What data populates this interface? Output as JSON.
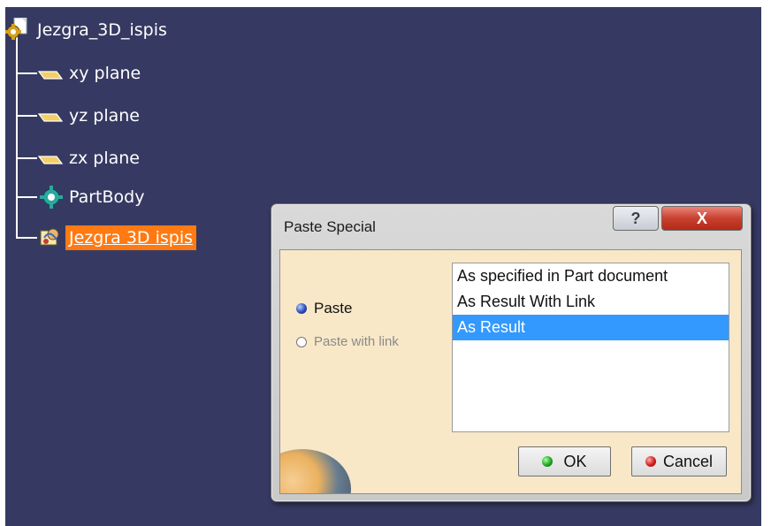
{
  "tree": {
    "root": {
      "label": "Jezgra_3D_ispis",
      "icon": "part-document-icon"
    },
    "children": [
      {
        "label": "xy plane",
        "icon": "plane-icon"
      },
      {
        "label": "yz plane",
        "icon": "plane-icon"
      },
      {
        "label": "zx plane",
        "icon": "plane-icon"
      },
      {
        "label": "PartBody",
        "icon": "gear-body-icon"
      },
      {
        "label": "Jezgra 3D ispis",
        "icon": "product-icon",
        "selected": true
      }
    ]
  },
  "dialog": {
    "title": "Paste Special",
    "help_label": "?",
    "close_label": "X",
    "radios": [
      {
        "label": "Paste",
        "checked": true,
        "enabled": true
      },
      {
        "label": "Paste with link",
        "checked": false,
        "enabled": false
      }
    ],
    "list": [
      {
        "label": "As specified in Part document",
        "selected": false
      },
      {
        "label": "As Result With Link",
        "selected": false
      },
      {
        "label": "As Result",
        "selected": true
      }
    ],
    "ok_label": "OK",
    "cancel_label": "Cancel"
  },
  "colors": {
    "viewport_bg": "#363a62",
    "selection": "#ff7a12",
    "list_selection": "#3399ff",
    "dialog_body": "#f8e8c8"
  }
}
